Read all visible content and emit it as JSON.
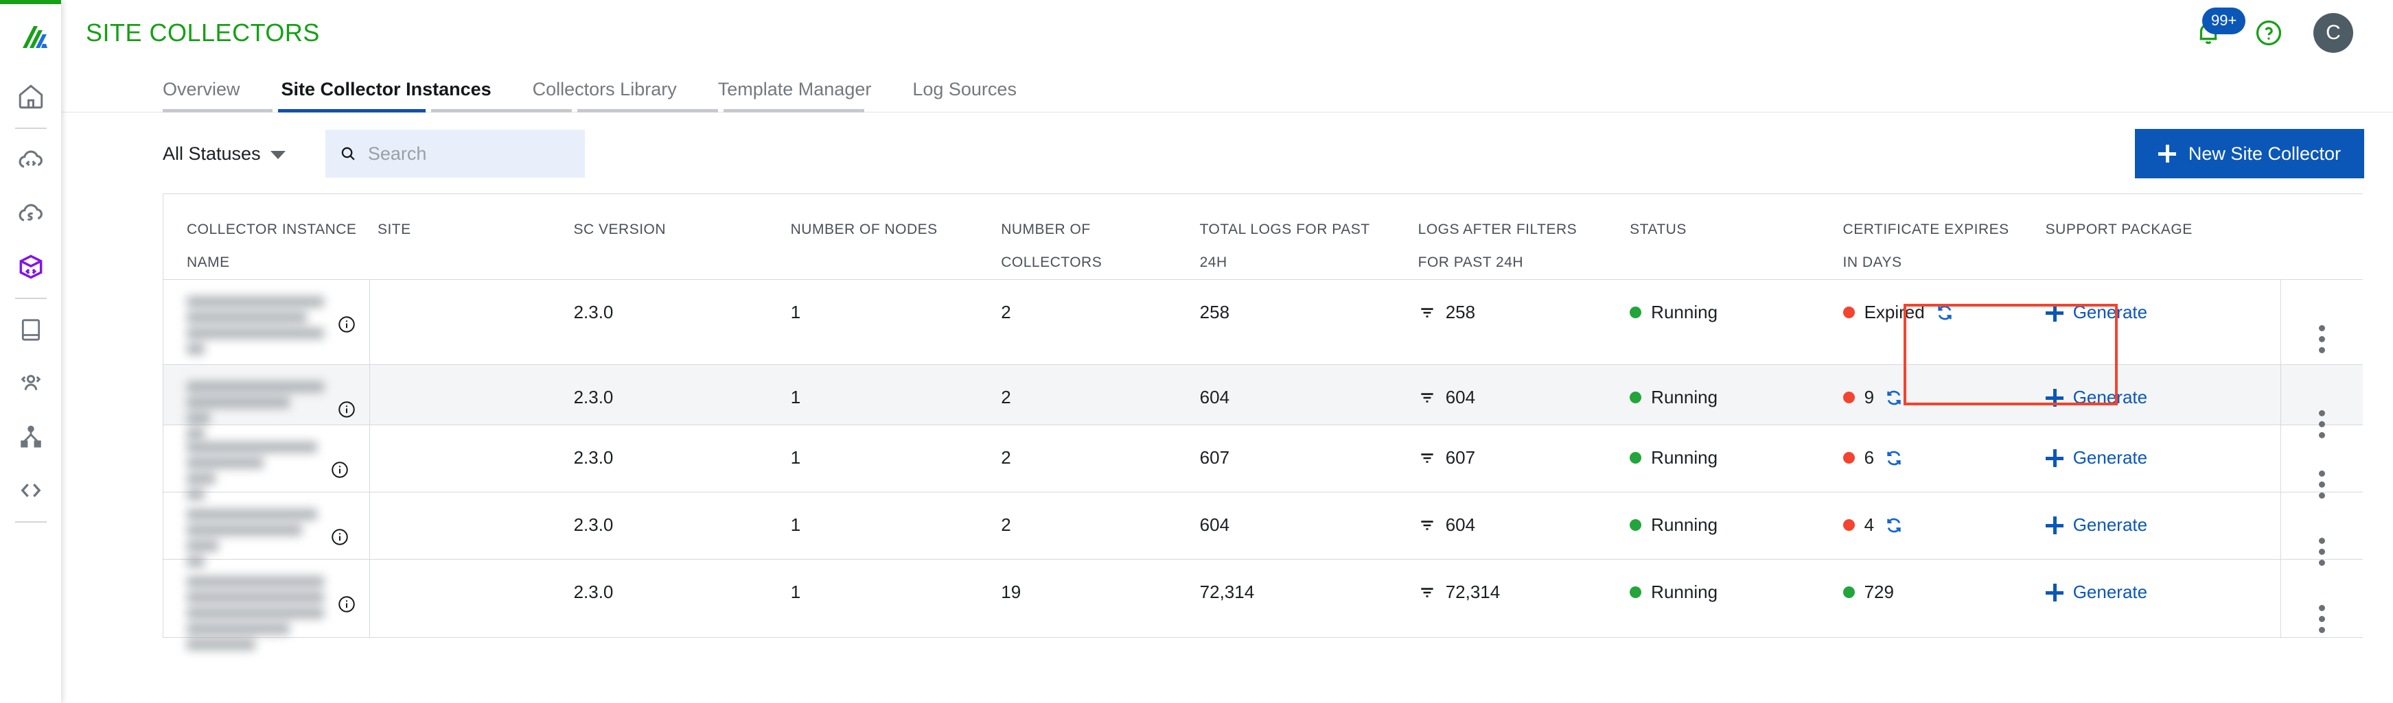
{
  "brand": {
    "accent_green": "#15a015",
    "accent_blue": "#0b57b8",
    "status_red": "#f4432e",
    "status_green": "#22a53a",
    "logo_name": "app-logo"
  },
  "header": {
    "title": "SITE COLLECTORS",
    "notification_badge": "99+",
    "avatar_initial": "C"
  },
  "sidebar": {
    "items": [
      {
        "name": "home-icon",
        "label": "Home"
      },
      {
        "name": "cloud-code-icon",
        "label": "Cloud Code"
      },
      {
        "name": "cloud-s-icon",
        "label": "Cloud S"
      },
      {
        "name": "cube-code-icon",
        "label": "Site Collectors"
      },
      {
        "name": "book-icon",
        "label": "Library"
      },
      {
        "name": "users-icon",
        "label": "Users"
      },
      {
        "name": "hierarchy-icon",
        "label": "Hierarchy"
      },
      {
        "name": "code-brackets-icon",
        "label": "Developer"
      }
    ]
  },
  "tabs": [
    {
      "label": "Overview",
      "active": false
    },
    {
      "label": "Site Collector Instances",
      "active": true
    },
    {
      "label": "Collectors Library",
      "active": false
    },
    {
      "label": "Template Manager",
      "active": false
    },
    {
      "label": "Log Sources",
      "active": false
    }
  ],
  "toolbar": {
    "status_filter_label": "All Statuses",
    "search_placeholder": "Search",
    "search_value": "",
    "new_button_label": "New Site Collector"
  },
  "table": {
    "columns": [
      {
        "key": "name",
        "line1": "COLLECTOR INSTANCE",
        "line2": "NAME"
      },
      {
        "key": "site",
        "line1": "SITE",
        "line2": ""
      },
      {
        "key": "ver",
        "line1": "SC VERSION",
        "line2": ""
      },
      {
        "key": "nodes",
        "line1": "NUMBER OF NODES",
        "line2": ""
      },
      {
        "key": "coll",
        "line1": "NUMBER OF",
        "line2": "COLLECTORS"
      },
      {
        "key": "total",
        "line1": "TOTAL LOGS FOR PAST",
        "line2": "24H"
      },
      {
        "key": "filt",
        "line1": "LOGS AFTER FILTERS",
        "line2": "FOR PAST 24H"
      },
      {
        "key": "status",
        "line1": "STATUS",
        "line2": ""
      },
      {
        "key": "cert",
        "line1": "CERTIFICATE EXPIRES",
        "line2": "IN DAYS"
      },
      {
        "key": "supp",
        "line1": "SUPPORT PACKAGE",
        "line2": ""
      }
    ],
    "rows": [
      {
        "name_redacted": true,
        "site": "",
        "ver": "2.3.0",
        "nodes": "1",
        "coll": "2",
        "total": "258",
        "filt": "258",
        "status": "Running",
        "status_color": "green",
        "cert": "Expired",
        "cert_color": "red",
        "cert_refresh": true,
        "support": "Generate",
        "highlighted": true,
        "alt": false
      },
      {
        "name_redacted": true,
        "site": "",
        "ver": "2.3.0",
        "nodes": "1",
        "coll": "2",
        "total": "604",
        "filt": "604",
        "status": "Running",
        "status_color": "green",
        "cert": "9",
        "cert_color": "red",
        "cert_refresh": true,
        "support": "Generate",
        "highlighted": false,
        "alt": true
      },
      {
        "name_redacted": true,
        "site": "",
        "ver": "2.3.0",
        "nodes": "1",
        "coll": "2",
        "total": "607",
        "filt": "607",
        "status": "Running",
        "status_color": "green",
        "cert": "6",
        "cert_color": "red",
        "cert_refresh": true,
        "support": "Generate",
        "highlighted": false,
        "alt": false
      },
      {
        "name_redacted": true,
        "site": "",
        "ver": "2.3.0",
        "nodes": "1",
        "coll": "2",
        "total": "604",
        "filt": "604",
        "status": "Running",
        "status_color": "green",
        "cert": "4",
        "cert_color": "red",
        "cert_refresh": true,
        "support": "Generate",
        "highlighted": false,
        "alt": false
      },
      {
        "name_redacted": true,
        "site": "",
        "ver": "2.3.0",
        "nodes": "1",
        "coll": "19",
        "total": "72,314",
        "filt": "72,314",
        "status": "Running",
        "status_color": "green",
        "cert": "729",
        "cert_color": "green",
        "cert_refresh": false,
        "support": "Generate",
        "highlighted": false,
        "alt": false
      }
    ]
  }
}
